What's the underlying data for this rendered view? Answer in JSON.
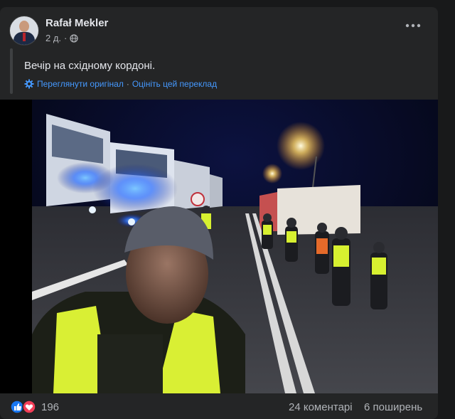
{
  "post": {
    "author": "Rafał Mekler",
    "time": "2 д.",
    "privacy_icon": "globe-icon",
    "text": "Вечір на східному кордоні.",
    "translation": {
      "icon": "gear-icon",
      "see_original": "Переглянути оригінал",
      "separator": "·",
      "rate": "Оцініть цей переклад"
    },
    "more_icon": "more-dots-icon"
  },
  "footer": {
    "reactions_count": "196",
    "comments": "24 коментарі",
    "shares": "6 поширень"
  },
  "colors": {
    "background": "#18191a",
    "card": "#242526",
    "text": "#e4e6eb",
    "secondary": "#b0b3b8",
    "link": "#4599ff",
    "like": "#1877f2",
    "love": "#f33e58"
  }
}
